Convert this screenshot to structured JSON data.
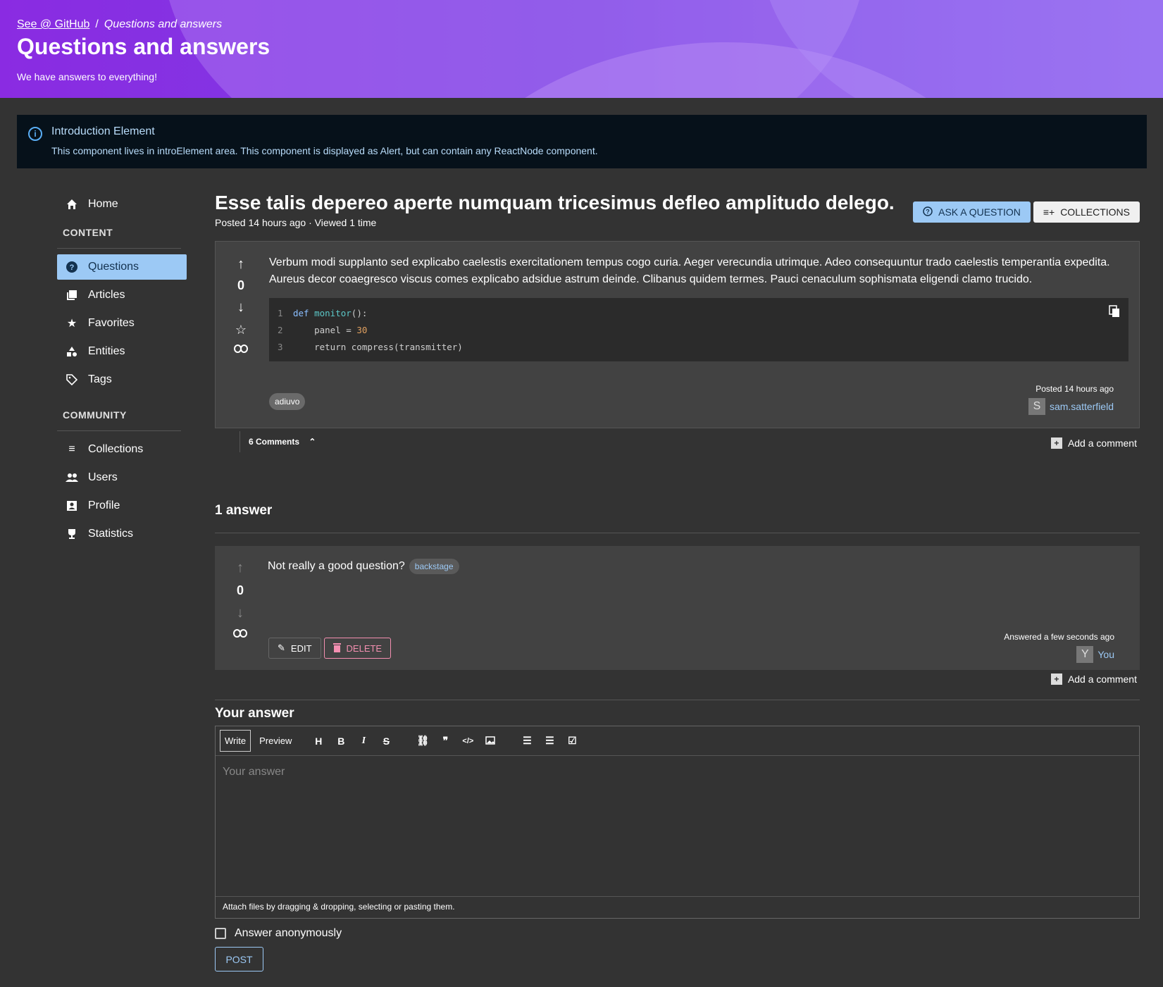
{
  "header": {
    "breadcrumb_link": "See @ GitHub",
    "breadcrumb_sep": "/",
    "breadcrumb_current": "Questions and answers",
    "title": "Questions and answers",
    "subtitle": "We have answers to everything!"
  },
  "alert": {
    "title": "Introduction Element",
    "text": "This component lives in introElement area. This component is displayed as Alert, but can contain any ReactNode component."
  },
  "sidebar": {
    "home": "Home",
    "content_head": "CONTENT",
    "content_items": [
      "Questions",
      "Articles",
      "Favorites",
      "Entities",
      "Tags"
    ],
    "community_head": "COMMUNITY",
    "community_items": [
      "Collections",
      "Users",
      "Profile",
      "Statistics"
    ]
  },
  "question": {
    "title": "Esse talis depereo aperte numquam tricesimus defleo amplitudo delego.",
    "meta": "Posted 14 hours ago · Viewed 1 time",
    "score": "0",
    "body": "Verbum modi supplanto sed explicabo caelestis exercitationem tempus cogo curia. Aeger verecundia utrimque. Adeo consequuntur trado caelestis temperantia expedita. Aureus decor coaegresco viscus comes explicabo adsidue astrum deinde. Clibanus quidem termes. Pauci cenaculum sophismata eligendi clamo trucido.",
    "code": {
      "line_numbers": [
        "1",
        "2",
        "3"
      ],
      "l1_kw": "def",
      "l1_fn": "monitor",
      "l1_rest": "():",
      "l2_pre": "    panel = ",
      "l2_num": "30",
      "l3": "    return compress(transmitter)"
    },
    "tag": "adiuvo",
    "posted": "Posted 14 hours ago",
    "author_initial": "S",
    "author": "sam.satterfield",
    "comments_label": "6 Comments",
    "add_comment": "Add a comment"
  },
  "buttons": {
    "ask": "ASK A QUESTION",
    "collections": "COLLECTIONS"
  },
  "answers": {
    "heading": "1 answer",
    "score": "0",
    "text": "Not really a good question?",
    "tag": "backstage",
    "edit": "EDIT",
    "delete": "DELETE",
    "posted": "Answered a few seconds ago",
    "author_initial": "Y",
    "author": "You",
    "add_comment": "Add a comment"
  },
  "editor": {
    "heading": "Your answer",
    "tab_write": "Write",
    "tab_preview": "Preview",
    "placeholder": "Your answer",
    "attach": "Attach files by dragging & dropping, selecting or pasting them.",
    "anonymous": "Answer anonymously",
    "post": "POST"
  }
}
